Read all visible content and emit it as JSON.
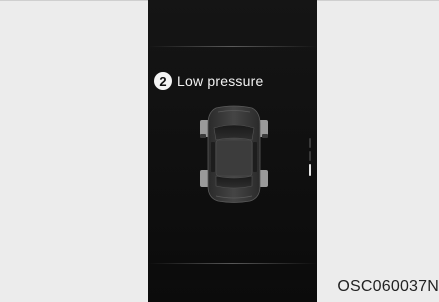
{
  "display": {
    "badge_number": "2",
    "title": "Low pressure",
    "icon": "car-top-view-icon"
  },
  "image_code": "OSC060037N",
  "colors": {
    "screen_background": "#111111",
    "text": "#f2f2f2",
    "car_body": "#3a3a3a"
  }
}
